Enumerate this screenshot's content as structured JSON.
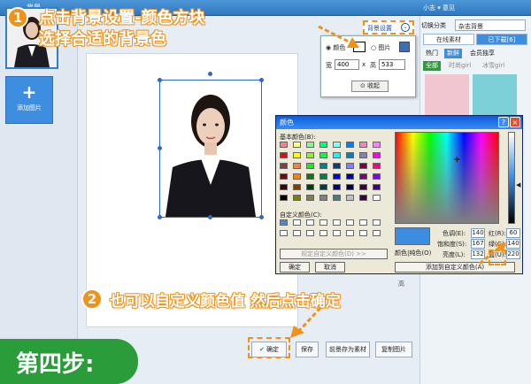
{
  "titlebar": {
    "title": "背景",
    "right_text": "小志 ▾ 意见"
  },
  "leftpanel": {
    "add_label": "添加图片"
  },
  "category": {
    "label": "切换分类",
    "value": "杂志背景"
  },
  "tabs": [
    {
      "label": "在线素材"
    },
    {
      "label": "已下载[6]"
    }
  ],
  "subtabs": [
    {
      "label": "全部"
    },
    {
      "label": "时尚girl"
    },
    {
      "label": "冰雪girl"
    }
  ],
  "filters": [
    {
      "label": "热门"
    },
    {
      "label": "新鲜"
    },
    {
      "label": "会员独享"
    }
  ],
  "bgpopup": {
    "color_label": "颜色",
    "image_label": "图片",
    "width_label": "宽",
    "width_value": "400",
    "x": "x",
    "height_label": "高",
    "height_value": "533",
    "collapse_label": "收起"
  },
  "bgset_button": "背景设置",
  "colordialog": {
    "title": "颜色",
    "basic_colors_label": "基本颜色(B):",
    "custom_colors_label": "自定义颜色(C):",
    "define_button": "规定自定义颜色(D) >>",
    "ok": "确定",
    "cancel": "取消",
    "add_custom": "添加到自定义颜色(A)",
    "color_solid": "颜色|纯色(O)",
    "hue_label": "色调(E):",
    "hue": "140",
    "sat_label": "饱和度(S):",
    "sat": "167",
    "lum_label": "亮度(L):",
    "lum": "132",
    "red_label": "红(R):",
    "red": "60",
    "green_label": "绿(G):",
    "green": "140",
    "blue_label": "蓝(U):",
    "blue": "220",
    "swatch_colors": [
      "#ff8080",
      "#ffff80",
      "#80ff80",
      "#00ff80",
      "#80ffff",
      "#0080ff",
      "#ff80c0",
      "#ff80ff",
      "#ff0000",
      "#ffff00",
      "#80ff00",
      "#00ff40",
      "#00ffff",
      "#0080c0",
      "#8080c0",
      "#ff00ff",
      "#804040",
      "#ff8040",
      "#00ff00",
      "#008080",
      "#004080",
      "#8080ff",
      "#800040",
      "#ff0080",
      "#800000",
      "#ff8000",
      "#008000",
      "#008040",
      "#0000ff",
      "#0000a0",
      "#800080",
      "#8000ff",
      "#400000",
      "#804000",
      "#004000",
      "#004040",
      "#000080",
      "#000040",
      "#400040",
      "#400080",
      "#000000",
      "#808000",
      "#808040",
      "#808080",
      "#408080",
      "#c0c0c0",
      "#400040",
      "#ffffff"
    ]
  },
  "steps": {
    "s1_num": "1",
    "s1_line1": "点击背景设置-颜色方块",
    "s1_line2": "选择合适的背景色",
    "s2_num": "2",
    "s2_text": "也可以自定义颜色值 然后点击确定",
    "s4": "第四步:"
  },
  "bottom": {
    "ok": "确定",
    "save": "保存",
    "save_material": "前景存为素材",
    "copy": "复制图片"
  },
  "side_hint": "高"
}
